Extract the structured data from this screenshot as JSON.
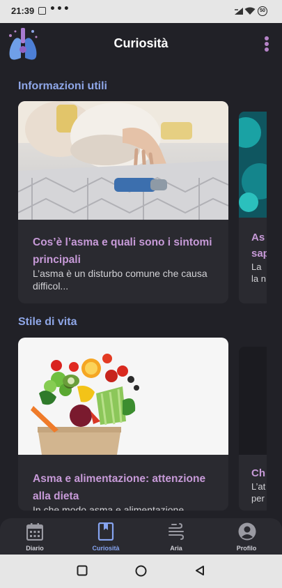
{
  "status": {
    "time": "21:39",
    "dots": "•••",
    "battery": "50"
  },
  "app_bar": {
    "title": "Curiosità"
  },
  "sections": [
    {
      "title": "Informazioni utili",
      "card": {
        "title": "Cos’è l’asma e quali sono i sintomi principali",
        "description": "L’asma è un disturbo comune che causa difficol..."
      },
      "peek": {
        "title_line1": "As",
        "title_line2": "sap",
        "desc_line1": "La",
        "desc_line2": "la n"
      }
    },
    {
      "title": "Stile di vita",
      "card": {
        "title": "Asma e alimentazione: attenzione alla dieta",
        "description": "In che modo asma e alimentazione"
      },
      "peek": {
        "title_line1": "Ch",
        "desc_line1": "L’at",
        "desc_line2": "per"
      }
    }
  ],
  "bottom_nav": [
    {
      "label": "Diario",
      "icon": "calendar-icon",
      "active": false
    },
    {
      "label": "Curiosità",
      "icon": "book-icon",
      "active": true
    },
    {
      "label": "Aria",
      "icon": "wind-icon",
      "active": false
    },
    {
      "label": "Profilo",
      "icon": "person-icon",
      "active": false
    }
  ],
  "colors": {
    "accent": "#86A4F0",
    "card_title": "#C79AD8",
    "background": "#212127"
  }
}
